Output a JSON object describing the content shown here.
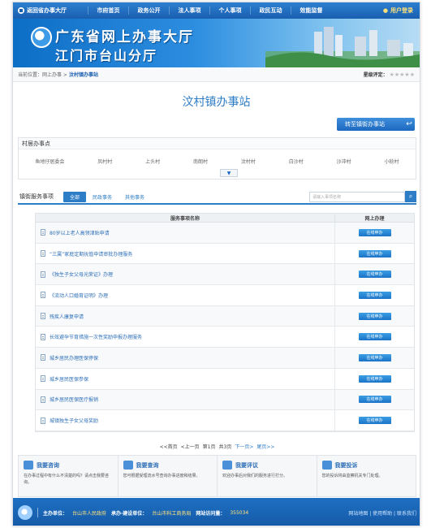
{
  "topnav": {
    "back_label": "返回省办事大厅",
    "items": [
      "市府首页",
      "政务公开",
      "法人事项",
      "个人事项",
      "政民互动",
      "效能监督"
    ],
    "login_label": "用户登录"
  },
  "banner": {
    "title_line1": "广东省网上办事大厅",
    "title_line2": "江门市台山分厅"
  },
  "breadcrumb": {
    "prefix": "当前位置：网上办事 >",
    "current": "汶村镇办事站",
    "rating_label": "星级评定：",
    "stars": "★★★★★"
  },
  "page_title": "汶村镇办事站",
  "switch_button": "转至镇街办事站",
  "village": {
    "heading": "村居办事点",
    "items": [
      "鱼地仔居委会",
      "凤村村",
      "上头村",
      "南朗村",
      "汶村村",
      "白沙村",
      "沙冲村",
      "小稔村"
    ]
  },
  "services": {
    "heading": "镇街服务事项",
    "tabs": [
      "全部",
      "民政事务",
      "其他事务"
    ],
    "search_placeholder": "请输入事项名称",
    "col_name": "服务事项名称",
    "col_action": "网上办理",
    "action_label": "在线申办",
    "rows": [
      "80岁以上老人高领津贴申请",
      "“三属”家庭定期抚恤申请审批办理服务",
      "《独生子女父母光荣证》办理",
      "《流动人口婚育证明》办理",
      "残疾人康复申请",
      "长效避孕节育措施一次性奖励申报办理服务",
      "城乡居民办理医保停保",
      "城乡居民医保参保",
      "城乡居民医保医疗报销",
      "城镇独生子女父母奖励"
    ]
  },
  "pager": {
    "first": "<<首页",
    "prev": "<上一页",
    "page": "第1页",
    "total": "共3页",
    "next": "下一页>",
    "last": "尾页>>"
  },
  "bottom_boxes": [
    {
      "title": "我要咨询",
      "desc": "在办事过程中有什么不清楚的吗？请点击我要咨询。"
    },
    {
      "title": "我要查询",
      "desc": "您可根据受理流水号查询办事进度和结果。"
    },
    {
      "title": "我要评议",
      "desc": "欢迎办事后对我们的服务进行打分。"
    },
    {
      "title": "我要投诉",
      "desc": "您的投诉将由监察机关专门处理。"
    }
  ],
  "footer": {
    "host_label": "主办单位：",
    "host": "台山市人民政府",
    "maint_label": "承办·建设单位：",
    "maint": "台山市科工商务局",
    "visits_label": "网站访问量：",
    "visits": "355034",
    "links": "网站地图 | 使用帮助 | 联系我们"
  }
}
